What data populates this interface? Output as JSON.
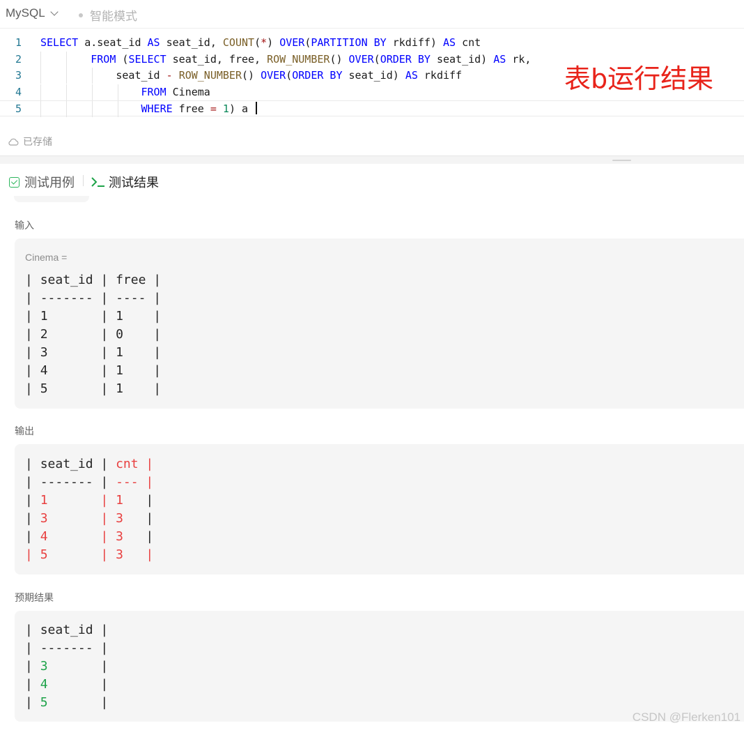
{
  "editor": {
    "language": "MySQL",
    "mode_label": "智能模式",
    "saved_status": "已存储",
    "annotation": "表b运行结果",
    "lines": [
      {
        "number": "1",
        "tokens": [
          {
            "t": "SELECT",
            "c": "kw"
          },
          {
            "t": " a.seat_id ",
            "c": ""
          },
          {
            "t": "AS",
            "c": "kw"
          },
          {
            "t": " seat_id, ",
            "c": ""
          },
          {
            "t": "COUNT",
            "c": "fn"
          },
          {
            "t": "(",
            "c": ""
          },
          {
            "t": "*",
            "c": "op"
          },
          {
            "t": ") ",
            "c": ""
          },
          {
            "t": "OVER",
            "c": "kw"
          },
          {
            "t": "(",
            "c": ""
          },
          {
            "t": "PARTITION BY",
            "c": "kw"
          },
          {
            "t": " rkdiff) ",
            "c": ""
          },
          {
            "t": "AS",
            "c": "kw"
          },
          {
            "t": " cnt",
            "c": ""
          }
        ]
      },
      {
        "number": "2",
        "tokens": [
          {
            "t": "        ",
            "c": ""
          },
          {
            "t": "FROM",
            "c": "kw"
          },
          {
            "t": " (",
            "c": ""
          },
          {
            "t": "SELECT",
            "c": "kw"
          },
          {
            "t": " seat_id, free, ",
            "c": ""
          },
          {
            "t": "ROW_NUMBER",
            "c": "fn"
          },
          {
            "t": "() ",
            "c": ""
          },
          {
            "t": "OVER",
            "c": "kw"
          },
          {
            "t": "(",
            "c": ""
          },
          {
            "t": "ORDER BY",
            "c": "kw"
          },
          {
            "t": " seat_id) ",
            "c": ""
          },
          {
            "t": "AS",
            "c": "kw"
          },
          {
            "t": " rk,",
            "c": ""
          }
        ]
      },
      {
        "number": "3",
        "tokens": [
          {
            "t": "            seat_id ",
            "c": ""
          },
          {
            "t": "-",
            "c": "op"
          },
          {
            "t": " ",
            "c": ""
          },
          {
            "t": "ROW_NUMBER",
            "c": "fn"
          },
          {
            "t": "() ",
            "c": ""
          },
          {
            "t": "OVER",
            "c": "kw"
          },
          {
            "t": "(",
            "c": ""
          },
          {
            "t": "ORDER BY",
            "c": "kw"
          },
          {
            "t": " seat_id) ",
            "c": ""
          },
          {
            "t": "AS",
            "c": "kw"
          },
          {
            "t": " rkdiff",
            "c": ""
          }
        ]
      },
      {
        "number": "4",
        "tokens": [
          {
            "t": "                ",
            "c": ""
          },
          {
            "t": "FROM",
            "c": "kw"
          },
          {
            "t": " Cinema",
            "c": ""
          }
        ]
      },
      {
        "number": "5",
        "tokens": [
          {
            "t": "                ",
            "c": ""
          },
          {
            "t": "WHERE",
            "c": "kw"
          },
          {
            "t": " free ",
            "c": ""
          },
          {
            "t": "=",
            "c": "op"
          },
          {
            "t": " ",
            "c": ""
          },
          {
            "t": "1",
            "c": "num"
          },
          {
            "t": ") a ",
            "c": ""
          }
        ]
      }
    ]
  },
  "tabs": {
    "cases_label": "测试用例",
    "results_label": "测试结果"
  },
  "input": {
    "label": "输入",
    "caption": "Cinema =",
    "header": [
      "seat_id",
      "free"
    ],
    "rows": [
      [
        "1",
        "1"
      ],
      [
        "2",
        "0"
      ],
      [
        "3",
        "1"
      ],
      [
        "4",
        "1"
      ],
      [
        "5",
        "1"
      ]
    ]
  },
  "output": {
    "label": "输出",
    "header": [
      "seat_id",
      "cnt"
    ],
    "rows": [
      [
        "1",
        "1"
      ],
      [
        "3",
        "3"
      ],
      [
        "4",
        "3"
      ],
      [
        "5",
        "3"
      ]
    ]
  },
  "expected": {
    "label": "预期结果",
    "header": [
      "seat_id"
    ],
    "rows": [
      [
        "3"
      ],
      [
        "4"
      ],
      [
        "5"
      ]
    ]
  },
  "watermark": "CSDN @Flerken101",
  "colors": {
    "keyword": "#0000ff",
    "function": "#795e26",
    "diff_red": "#e84040",
    "expected_green": "#1fa34a",
    "annotation_red": "#e8231a"
  }
}
